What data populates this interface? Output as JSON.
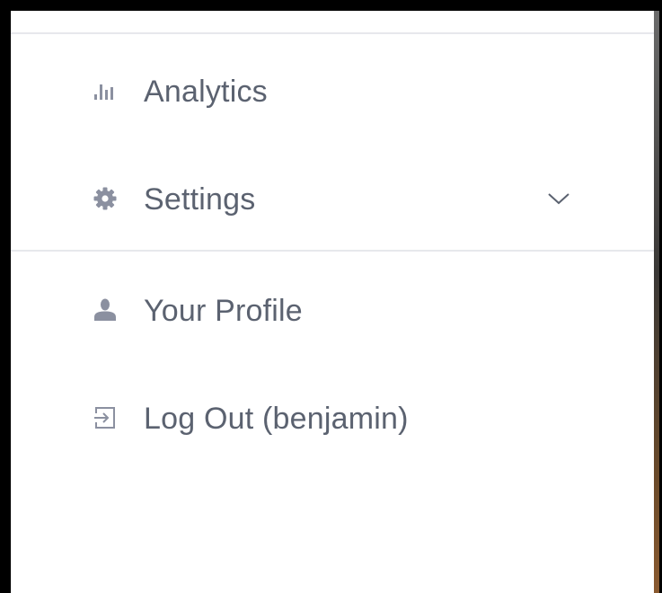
{
  "menu": {
    "items": [
      {
        "label": "Analytics",
        "icon": "bar-chart-icon"
      },
      {
        "label": "Settings",
        "icon": "gear-icon",
        "chevron": "chevron-down-icon"
      },
      {
        "label": "Your Profile",
        "icon": "user-icon"
      },
      {
        "label": "Log Out (benjamin)",
        "icon": "logout-icon"
      }
    ]
  },
  "colors": {
    "text": "#5b6270",
    "icon": "#8b90a0",
    "divider": "#e7e8ec",
    "background": "#ffffff",
    "frame": "#000000"
  }
}
